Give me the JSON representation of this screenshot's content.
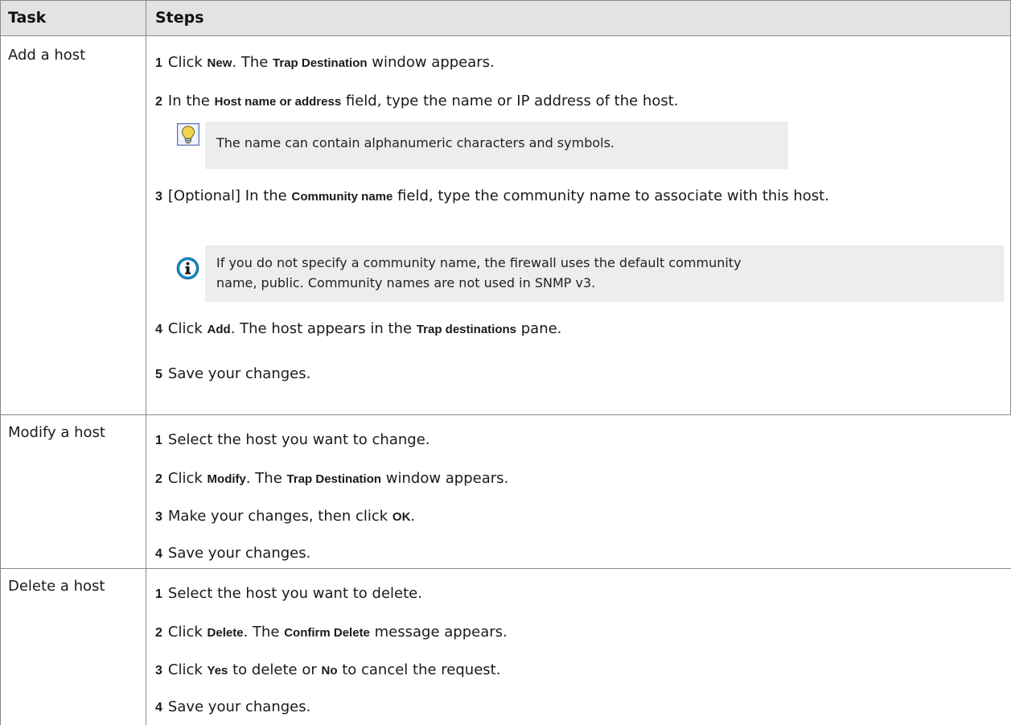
{
  "header": {
    "task": "Task",
    "steps": "Steps"
  },
  "rows": [
    {
      "task": "Add a host",
      "steps": [
        {
          "n": "1",
          "t1": "Click ",
          "b1": "New",
          "t2": ". The ",
          "b2": "Trap Destination",
          "t3": " window appears."
        },
        {
          "n": "2",
          "t1": "In the ",
          "b1": "Host name or address",
          "t2": " field, type the name or IP address of the host."
        },
        {
          "n": "3",
          "t1": "[Optional] In the ",
          "b1": "Community name",
          "t2": " field, type the community name to associate with this host."
        },
        {
          "n": "4",
          "t1": "Click ",
          "b1": "Add",
          "t2": ". The host appears in the ",
          "b2": "Trap destinations",
          "t3": " pane."
        },
        {
          "n": "5",
          "t1": "Save your changes."
        }
      ],
      "tip": "The name can contain alphanumeric characters and symbols.",
      "note_line1": "If you do not specify a community name, the firewall uses the default community",
      "note_line2": "name, public. Community names are not used in SNMP v3."
    },
    {
      "task": "Modify a host",
      "steps": [
        {
          "n": "1",
          "t1": "Select the host you want to change."
        },
        {
          "n": "2",
          "t1": "Click ",
          "b1": "Modify",
          "t2": ". The ",
          "b2": "Trap Destination",
          "t3": " window appears."
        },
        {
          "n": "3",
          "t1": "Make your changes, then click ",
          "b1": "OK",
          "t2": "."
        },
        {
          "n": "4",
          "t1": "Save your changes."
        }
      ]
    },
    {
      "task": "Delete a host",
      "steps": [
        {
          "n": "1",
          "t1": "Select the host you want to delete."
        },
        {
          "n": "2",
          "t1": "Click ",
          "b1": "Delete",
          "t2": ". The ",
          "b2": "Confirm Delete",
          "t3": " message appears."
        },
        {
          "n": "3",
          "t1": "Click ",
          "b1": "Yes",
          "t2": " to delete or ",
          "b2": "No",
          "t3": " to cancel the request."
        },
        {
          "n": "4",
          "t1": "Save your changes."
        }
      ]
    }
  ],
  "icons": {
    "tip": "lightbulb-icon",
    "note": "info-icon"
  },
  "colors": {
    "header_bg": "#e3e3e3",
    "note_bg": "#ededed",
    "border": "#8a8a8a",
    "info_icon": "#1f8fc9",
    "tip_icon": "#f2d54c"
  }
}
